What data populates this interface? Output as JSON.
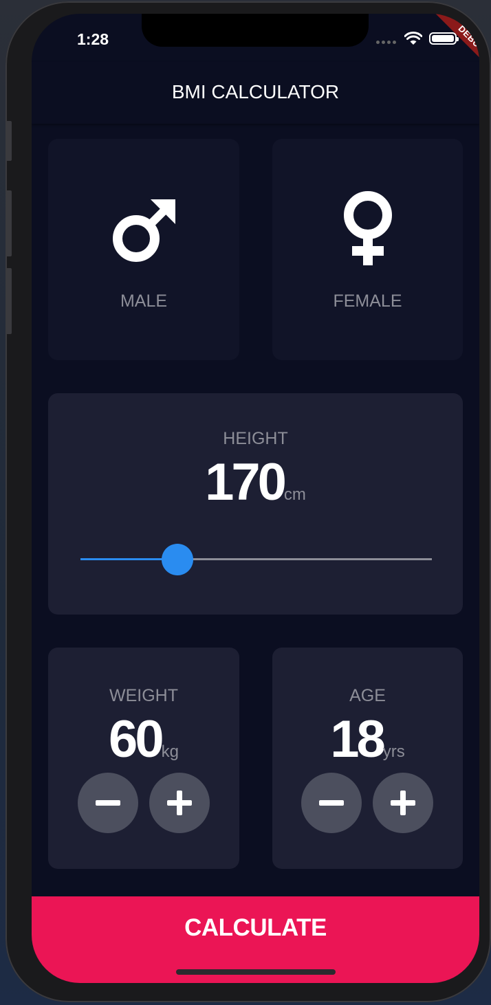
{
  "status_bar": {
    "time": "1:28",
    "debug_banner": "DEBUG"
  },
  "app_bar": {
    "title": "BMI CALCULATOR"
  },
  "gender": {
    "male_label": "MALE",
    "female_label": "FEMALE",
    "male_icon": "mars-icon",
    "female_icon": "venus-icon"
  },
  "height": {
    "label": "HEIGHT",
    "value": "170",
    "unit": "cm",
    "slider_fraction": 0.275
  },
  "weight": {
    "label": "WEIGHT",
    "value": "60",
    "unit": "kg",
    "minus_icon": "minus-icon",
    "plus_icon": "plus-icon"
  },
  "age": {
    "label": "AGE",
    "value": "18",
    "unit": "yrs",
    "minus_icon": "minus-icon",
    "plus_icon": "plus-icon"
  },
  "calculate": {
    "label": "CALCULATE"
  },
  "colors": {
    "background": "#0b0e21",
    "card_active": "#1d1f33",
    "card_inactive": "#111428",
    "accent": "#eb1555",
    "slider": "#2a8cf0",
    "label": "#8d8e98"
  }
}
